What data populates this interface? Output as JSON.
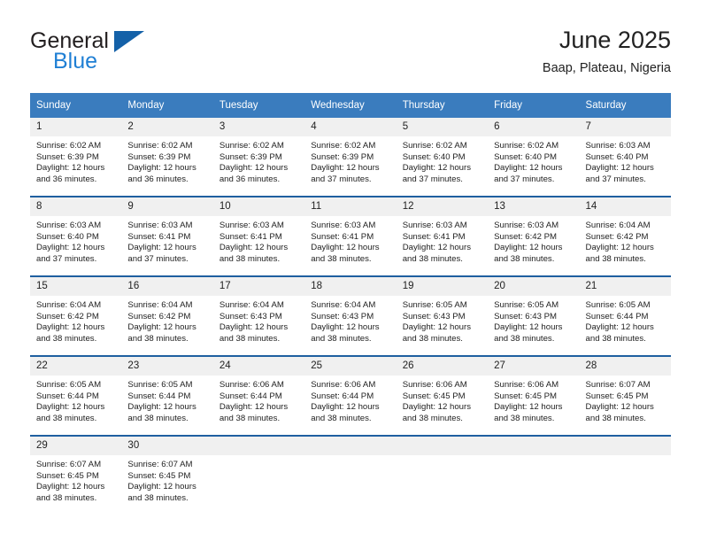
{
  "logo": {
    "primary_text": "General",
    "secondary_text": "Blue",
    "primary_color": "#231f20",
    "secondary_color": "#1f7fd4",
    "triangle_color": "#1461a8"
  },
  "header": {
    "title": "June 2025",
    "location": "Baap, Plateau, Nigeria"
  },
  "colors": {
    "header_blue": "#3a7cbe",
    "row_border_blue": "#1f5fa0",
    "daynum_band": "#f0f0f0",
    "text": "#222222"
  },
  "weekdays": [
    "Sunday",
    "Monday",
    "Tuesday",
    "Wednesday",
    "Thursday",
    "Friday",
    "Saturday"
  ],
  "weeks": [
    [
      {
        "day": "1",
        "sunrise": "Sunrise: 6:02 AM",
        "sunset": "Sunset: 6:39 PM",
        "daylight_line1": "Daylight: 12 hours",
        "daylight_line2": "and 36 minutes."
      },
      {
        "day": "2",
        "sunrise": "Sunrise: 6:02 AM",
        "sunset": "Sunset: 6:39 PM",
        "daylight_line1": "Daylight: 12 hours",
        "daylight_line2": "and 36 minutes."
      },
      {
        "day": "3",
        "sunrise": "Sunrise: 6:02 AM",
        "sunset": "Sunset: 6:39 PM",
        "daylight_line1": "Daylight: 12 hours",
        "daylight_line2": "and 36 minutes."
      },
      {
        "day": "4",
        "sunrise": "Sunrise: 6:02 AM",
        "sunset": "Sunset: 6:39 PM",
        "daylight_line1": "Daylight: 12 hours",
        "daylight_line2": "and 37 minutes."
      },
      {
        "day": "5",
        "sunrise": "Sunrise: 6:02 AM",
        "sunset": "Sunset: 6:40 PM",
        "daylight_line1": "Daylight: 12 hours",
        "daylight_line2": "and 37 minutes."
      },
      {
        "day": "6",
        "sunrise": "Sunrise: 6:02 AM",
        "sunset": "Sunset: 6:40 PM",
        "daylight_line1": "Daylight: 12 hours",
        "daylight_line2": "and 37 minutes."
      },
      {
        "day": "7",
        "sunrise": "Sunrise: 6:03 AM",
        "sunset": "Sunset: 6:40 PM",
        "daylight_line1": "Daylight: 12 hours",
        "daylight_line2": "and 37 minutes."
      }
    ],
    [
      {
        "day": "8",
        "sunrise": "Sunrise: 6:03 AM",
        "sunset": "Sunset: 6:40 PM",
        "daylight_line1": "Daylight: 12 hours",
        "daylight_line2": "and 37 minutes."
      },
      {
        "day": "9",
        "sunrise": "Sunrise: 6:03 AM",
        "sunset": "Sunset: 6:41 PM",
        "daylight_line1": "Daylight: 12 hours",
        "daylight_line2": "and 37 minutes."
      },
      {
        "day": "10",
        "sunrise": "Sunrise: 6:03 AM",
        "sunset": "Sunset: 6:41 PM",
        "daylight_line1": "Daylight: 12 hours",
        "daylight_line2": "and 38 minutes."
      },
      {
        "day": "11",
        "sunrise": "Sunrise: 6:03 AM",
        "sunset": "Sunset: 6:41 PM",
        "daylight_line1": "Daylight: 12 hours",
        "daylight_line2": "and 38 minutes."
      },
      {
        "day": "12",
        "sunrise": "Sunrise: 6:03 AM",
        "sunset": "Sunset: 6:41 PM",
        "daylight_line1": "Daylight: 12 hours",
        "daylight_line2": "and 38 minutes."
      },
      {
        "day": "13",
        "sunrise": "Sunrise: 6:03 AM",
        "sunset": "Sunset: 6:42 PM",
        "daylight_line1": "Daylight: 12 hours",
        "daylight_line2": "and 38 minutes."
      },
      {
        "day": "14",
        "sunrise": "Sunrise: 6:04 AM",
        "sunset": "Sunset: 6:42 PM",
        "daylight_line1": "Daylight: 12 hours",
        "daylight_line2": "and 38 minutes."
      }
    ],
    [
      {
        "day": "15",
        "sunrise": "Sunrise: 6:04 AM",
        "sunset": "Sunset: 6:42 PM",
        "daylight_line1": "Daylight: 12 hours",
        "daylight_line2": "and 38 minutes."
      },
      {
        "day": "16",
        "sunrise": "Sunrise: 6:04 AM",
        "sunset": "Sunset: 6:42 PM",
        "daylight_line1": "Daylight: 12 hours",
        "daylight_line2": "and 38 minutes."
      },
      {
        "day": "17",
        "sunrise": "Sunrise: 6:04 AM",
        "sunset": "Sunset: 6:43 PM",
        "daylight_line1": "Daylight: 12 hours",
        "daylight_line2": "and 38 minutes."
      },
      {
        "day": "18",
        "sunrise": "Sunrise: 6:04 AM",
        "sunset": "Sunset: 6:43 PM",
        "daylight_line1": "Daylight: 12 hours",
        "daylight_line2": "and 38 minutes."
      },
      {
        "day": "19",
        "sunrise": "Sunrise: 6:05 AM",
        "sunset": "Sunset: 6:43 PM",
        "daylight_line1": "Daylight: 12 hours",
        "daylight_line2": "and 38 minutes."
      },
      {
        "day": "20",
        "sunrise": "Sunrise: 6:05 AM",
        "sunset": "Sunset: 6:43 PM",
        "daylight_line1": "Daylight: 12 hours",
        "daylight_line2": "and 38 minutes."
      },
      {
        "day": "21",
        "sunrise": "Sunrise: 6:05 AM",
        "sunset": "Sunset: 6:44 PM",
        "daylight_line1": "Daylight: 12 hours",
        "daylight_line2": "and 38 minutes."
      }
    ],
    [
      {
        "day": "22",
        "sunrise": "Sunrise: 6:05 AM",
        "sunset": "Sunset: 6:44 PM",
        "daylight_line1": "Daylight: 12 hours",
        "daylight_line2": "and 38 minutes."
      },
      {
        "day": "23",
        "sunrise": "Sunrise: 6:05 AM",
        "sunset": "Sunset: 6:44 PM",
        "daylight_line1": "Daylight: 12 hours",
        "daylight_line2": "and 38 minutes."
      },
      {
        "day": "24",
        "sunrise": "Sunrise: 6:06 AM",
        "sunset": "Sunset: 6:44 PM",
        "daylight_line1": "Daylight: 12 hours",
        "daylight_line2": "and 38 minutes."
      },
      {
        "day": "25",
        "sunrise": "Sunrise: 6:06 AM",
        "sunset": "Sunset: 6:44 PM",
        "daylight_line1": "Daylight: 12 hours",
        "daylight_line2": "and 38 minutes."
      },
      {
        "day": "26",
        "sunrise": "Sunrise: 6:06 AM",
        "sunset": "Sunset: 6:45 PM",
        "daylight_line1": "Daylight: 12 hours",
        "daylight_line2": "and 38 minutes."
      },
      {
        "day": "27",
        "sunrise": "Sunrise: 6:06 AM",
        "sunset": "Sunset: 6:45 PM",
        "daylight_line1": "Daylight: 12 hours",
        "daylight_line2": "and 38 minutes."
      },
      {
        "day": "28",
        "sunrise": "Sunrise: 6:07 AM",
        "sunset": "Sunset: 6:45 PM",
        "daylight_line1": "Daylight: 12 hours",
        "daylight_line2": "and 38 minutes."
      }
    ],
    [
      {
        "day": "29",
        "sunrise": "Sunrise: 6:07 AM",
        "sunset": "Sunset: 6:45 PM",
        "daylight_line1": "Daylight: 12 hours",
        "daylight_line2": "and 38 minutes."
      },
      {
        "day": "30",
        "sunrise": "Sunrise: 6:07 AM",
        "sunset": "Sunset: 6:45 PM",
        "daylight_line1": "Daylight: 12 hours",
        "daylight_line2": "and 38 minutes."
      },
      {
        "day": "",
        "sunrise": "",
        "sunset": "",
        "daylight_line1": "",
        "daylight_line2": "",
        "empty": true
      },
      {
        "day": "",
        "sunrise": "",
        "sunset": "",
        "daylight_line1": "",
        "daylight_line2": "",
        "empty": true
      },
      {
        "day": "",
        "sunrise": "",
        "sunset": "",
        "daylight_line1": "",
        "daylight_line2": "",
        "empty": true
      },
      {
        "day": "",
        "sunrise": "",
        "sunset": "",
        "daylight_line1": "",
        "daylight_line2": "",
        "empty": true
      },
      {
        "day": "",
        "sunrise": "",
        "sunset": "",
        "daylight_line1": "",
        "daylight_line2": "",
        "empty": true
      }
    ]
  ]
}
